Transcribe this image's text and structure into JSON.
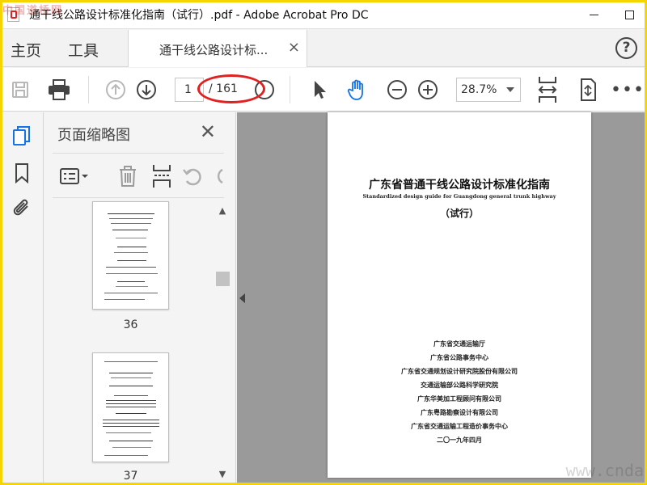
{
  "window": {
    "title": "通干线公路设计标准化指南（试行）.pdf - Adobe Acrobat Pro DC"
  },
  "watermarks": {
    "top_left": "中国道桥网",
    "bottom_right": "www.cnda"
  },
  "nav": {
    "home": "主页",
    "tools": "工具",
    "doc_tab": "通干线公路设计标...",
    "doc_tab_close": "×",
    "help": "?"
  },
  "toolbar": {
    "current_page": "1",
    "total_pages": "/ 161",
    "zoom": "28.7%",
    "more": "•••"
  },
  "panel": {
    "title": "页面缩略图",
    "close": "✕",
    "thumbnails": [
      {
        "page": "36"
      },
      {
        "page": "37"
      }
    ]
  },
  "document": {
    "title": "广东省普通干线公路设计标准化指南",
    "subtitle": "Standardized design guide for Guangdong general trunk highway",
    "trial": "（试行）",
    "organizations": [
      "广东省交通运输厅",
      "广东省公路事务中心",
      "广东省交通规划设计研究院股份有限公司",
      "交通运输部公路科学研究院",
      "广东华美加工程顾问有限公司",
      "广东粤路勘察设计有限公司",
      "广东省交通运输工程造价事务中心",
      "二〇一九年四月"
    ]
  },
  "colors": {
    "accent_blue": "#1473e6",
    "highlight_red": "#e12020",
    "frame_yellow": "#f5d400"
  }
}
